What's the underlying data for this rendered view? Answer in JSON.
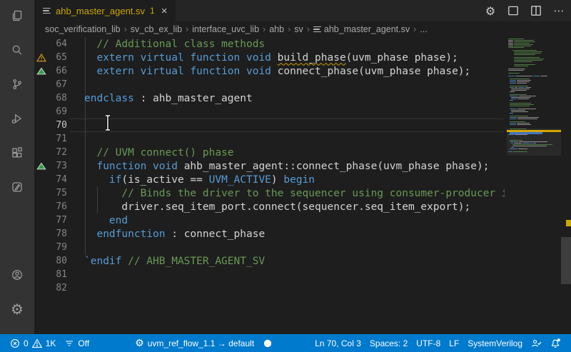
{
  "window": {
    "tab": {
      "label": "ahb_master_agent.sv",
      "badge": "1",
      "close_glyph": "×"
    },
    "editor_actions": [
      {
        "name": "settings-gear"
      },
      {
        "name": "customize-layout"
      },
      {
        "name": "split-editor"
      },
      {
        "name": "more-actions"
      }
    ]
  },
  "breadcrumb": {
    "separator": "›",
    "items": [
      {
        "label": "soc_verification_lib"
      },
      {
        "label": "sv_cb_ex_lib"
      },
      {
        "label": "interface_uvc_lib"
      },
      {
        "label": "ahb"
      },
      {
        "label": "sv"
      },
      {
        "label": "ahb_master_agent.sv",
        "icon": "file"
      },
      {
        "label": "..."
      }
    ]
  },
  "activity_bar": {
    "top": [
      "explorer",
      "search",
      "source-control",
      "run-debug",
      "extensions",
      "notebook-pencil"
    ],
    "bottom": [
      "account",
      "settings-gear"
    ]
  },
  "editor": {
    "current_line": 70,
    "cursor": {
      "line": 70,
      "col": 3
    },
    "lines": [
      {
        "n": 64,
        "tokens": [
          [
            "  // Additional class methods",
            "cm"
          ]
        ]
      },
      {
        "n": 65,
        "gutter": "warning",
        "tokens": [
          [
            "  ",
            "pl"
          ],
          [
            "extern virtual function void ",
            "kw"
          ],
          [
            "build_phase",
            "sq"
          ],
          [
            "(uvm_phase phase);",
            "pl"
          ]
        ]
      },
      {
        "n": 66,
        "gutter": "pass",
        "tokens": [
          [
            "  ",
            "pl"
          ],
          [
            "extern virtual function void ",
            "kw"
          ],
          [
            "connect_phase(uvm_phase phase);",
            "pl"
          ]
        ]
      },
      {
        "n": 67,
        "tokens": []
      },
      {
        "n": 68,
        "tokens": [
          [
            "endclass",
            "kw"
          ],
          [
            " : ahb_master_agent",
            "pl"
          ]
        ]
      },
      {
        "n": 69,
        "tokens": []
      },
      {
        "n": 70,
        "tokens": []
      },
      {
        "n": 71,
        "tokens": []
      },
      {
        "n": 72,
        "tokens": [
          [
            "  // UVM connect() phase",
            "cm"
          ]
        ]
      },
      {
        "n": 73,
        "gutter": "pass",
        "tokens": [
          [
            "  ",
            "pl"
          ],
          [
            "function",
            "kw"
          ],
          [
            " ",
            "pl"
          ],
          [
            "void",
            "kw"
          ],
          [
            " ahb_master_agent::connect_phase(uvm_phase phase);",
            "pl"
          ]
        ]
      },
      {
        "n": 74,
        "tokens": [
          [
            "    ",
            "pl"
          ],
          [
            "if",
            "kw"
          ],
          [
            "(is_active == ",
            "pl"
          ],
          [
            "UVM_ACTIVE",
            "kw"
          ],
          [
            ") ",
            "pl"
          ],
          [
            "begin",
            "kw"
          ]
        ]
      },
      {
        "n": 75,
        "tokens": [
          [
            "      // Binds the driver to the sequencer using consumer-producer interface",
            "cm"
          ]
        ]
      },
      {
        "n": 76,
        "tokens": [
          [
            "      driver.seq_item_port.connect(sequencer.seq_item_export);",
            "pl"
          ]
        ]
      },
      {
        "n": 77,
        "tokens": [
          [
            "    ",
            "pl"
          ],
          [
            "end",
            "kw"
          ]
        ]
      },
      {
        "n": 78,
        "tokens": [
          [
            "  ",
            "pl"
          ],
          [
            "endfunction",
            "kw"
          ],
          [
            " : connect_phase",
            "pl"
          ]
        ]
      },
      {
        "n": 79,
        "tokens": []
      },
      {
        "n": 80,
        "tokens": [
          [
            "`endif ",
            "kw"
          ],
          [
            "// AHB_MASTER_AGENT_SV",
            "cm"
          ]
        ]
      },
      {
        "n": 81,
        "tokens": []
      },
      {
        "n": 82,
        "tokens": []
      }
    ]
  },
  "minimap": {
    "pitch": 2,
    "warning_line": 65,
    "blue_line": 66,
    "viewport": {
      "from": 64,
      "to": 82
    },
    "rows": [
      [
        2,
        [
          [
            22,
            "g"
          ]
        ]
      ],
      [
        2,
        [
          [
            7,
            "w"
          ],
          [
            28,
            "g"
          ]
        ]
      ],
      [
        2,
        [
          [
            7,
            "w"
          ],
          [
            30,
            "g"
          ]
        ]
      ],
      [
        2,
        [
          [
            7,
            "w"
          ],
          [
            22,
            "g"
          ]
        ]
      ],
      [
        2,
        [
          [
            7,
            "w"
          ],
          [
            27,
            "g"
          ]
        ]
      ],
      [
        2,
        [
          [
            7,
            "w"
          ],
          [
            24,
            "g"
          ]
        ]
      ],
      [
        2,
        [
          [
            22,
            "g"
          ]
        ]
      ],
      null,
      [
        8,
        [
          [
            34,
            "g"
          ]
        ]
      ],
      [
        10,
        [
          [
            40,
            "g"
          ]
        ]
      ],
      [
        10,
        [
          [
            38,
            "g"
          ]
        ]
      ],
      [
        10,
        [
          [
            30,
            "g"
          ]
        ]
      ],
      null,
      [
        10,
        [
          [
            36,
            "g"
          ]
        ]
      ],
      [
        10,
        [
          [
            42,
            "g"
          ]
        ]
      ],
      [
        10,
        [
          [
            40,
            "g"
          ]
        ]
      ],
      [
        10,
        [
          [
            26,
            "g"
          ]
        ]
      ],
      null,
      [
        10,
        [
          [
            30,
            "g"
          ]
        ]
      ],
      [
        10,
        [
          [
            20,
            "g"
          ]
        ]
      ],
      null,
      [
        2,
        [
          [
            24,
            "w"
          ]
        ]
      ],
      [
        2,
        [
          [
            22,
            "w"
          ]
        ]
      ],
      null,
      [
        2,
        [
          [
            16,
            "g"
          ]
        ]
      ],
      null,
      [
        2,
        [
          [
            9,
            "b"
          ],
          [
            24,
            "w"
          ],
          [
            9,
            "b"
          ],
          [
            10,
            "w"
          ]
        ]
      ],
      null,
      [
        4,
        [
          [
            28,
            "g"
          ]
        ]
      ],
      [
        4,
        [
          [
            9,
            "b"
          ],
          [
            20,
            "w"
          ]
        ]
      ],
      [
        4,
        [
          [
            9,
            "b"
          ],
          [
            18,
            "w"
          ]
        ]
      ],
      [
        4,
        [
          [
            9,
            "b"
          ],
          [
            14,
            "w"
          ]
        ]
      ],
      null,
      [
        4,
        [
          [
            26,
            "g"
          ]
        ]
      ],
      [
        4,
        [
          [
            6,
            "b"
          ],
          [
            4,
            "w"
          ],
          [
            9,
            "b"
          ],
          [
            8,
            "w"
          ]
        ]
      ],
      [
        6,
        [
          [
            26,
            "w"
          ]
        ]
      ],
      [
        6,
        [
          [
            22,
            "w"
          ]
        ]
      ],
      [
        4,
        [
          [
            7,
            "w"
          ]
        ]
      ],
      null,
      [
        4,
        [
          [
            24,
            "g"
          ]
        ]
      ],
      [
        4,
        [
          [
            12,
            "b"
          ],
          [
            24,
            "w"
          ]
        ]
      ],
      [
        6,
        [
          [
            28,
            "w"
          ]
        ]
      ],
      [
        6,
        [
          [
            8,
            "b"
          ],
          [
            16,
            "w"
          ]
        ]
      ],
      [
        4,
        [
          [
            5,
            "b"
          ]
        ]
      ],
      null,
      [
        4,
        [
          [
            30,
            "g"
          ]
        ]
      ],
      [
        4,
        [
          [
            34,
            "g"
          ]
        ]
      ],
      [
        4,
        [
          [
            28,
            "g"
          ]
        ]
      ],
      null,
      [
        4,
        [
          [
            10,
            "b"
          ],
          [
            26,
            "w"
          ]
        ]
      ],
      [
        6,
        [
          [
            20,
            "w"
          ]
        ]
      ],
      [
        6,
        [
          [
            24,
            "w"
          ]
        ]
      ],
      [
        4,
        [
          [
            5,
            "b"
          ]
        ]
      ],
      null,
      [
        4,
        [
          [
            26,
            "g"
          ]
        ]
      ],
      [
        4,
        [
          [
            10,
            "b"
          ],
          [
            30,
            "w"
          ]
        ]
      ],
      [
        4,
        [
          [
            10,
            "b"
          ],
          [
            28,
            "w"
          ]
        ]
      ],
      null,
      [
        4,
        [
          [
            22,
            "g"
          ]
        ]
      ],
      [
        4,
        [
          [
            9,
            "b"
          ],
          [
            18,
            "w"
          ]
        ]
      ],
      [
        4,
        [
          [
            9,
            "b"
          ],
          [
            20,
            "w"
          ]
        ]
      ],
      null,
      null,
      [
        4,
        [
          [
            24,
            "g"
          ]
        ]
      ],
      [
        4,
        [
          [
            26,
            "b"
          ],
          [
            26,
            "w"
          ]
        ]
      ],
      [
        4,
        [
          [
            26,
            "b"
          ],
          [
            28,
            "w"
          ]
        ]
      ],
      null,
      [
        2,
        [
          [
            8,
            "b"
          ],
          [
            18,
            "w"
          ]
        ]
      ],
      null,
      null,
      null,
      [
        4,
        [
          [
            18,
            "g"
          ]
        ]
      ],
      [
        4,
        [
          [
            12,
            "b"
          ],
          [
            40,
            "w"
          ]
        ]
      ],
      [
        6,
        [
          [
            3,
            "b"
          ],
          [
            11,
            "w"
          ],
          [
            10,
            "b"
          ],
          [
            2,
            "w"
          ],
          [
            5,
            "b"
          ]
        ]
      ],
      [
        8,
        [
          [
            56,
            "g"
          ]
        ]
      ],
      [
        8,
        [
          [
            48,
            "w"
          ]
        ]
      ],
      [
        6,
        [
          [
            4,
            "b"
          ]
        ]
      ],
      [
        4,
        [
          [
            11,
            "b"
          ],
          [
            13,
            "w"
          ]
        ]
      ],
      null,
      [
        2,
        [
          [
            6,
            "b"
          ],
          [
            20,
            "g"
          ]
        ]
      ],
      null,
      null
    ]
  },
  "status_bar": {
    "problems": {
      "error_count": "0",
      "warning_count": "1K"
    },
    "items_left": [
      {
        "icon": "filter",
        "label": "Off"
      },
      {
        "icon": "gear",
        "label": "uvm_ref_flow_1.1 → default",
        "gap": true
      },
      {
        "icon": "circle-filled",
        "label": ""
      }
    ],
    "items_right": [
      {
        "label": "Ln 70, Col 3"
      },
      {
        "label": "Spaces: 2"
      },
      {
        "label": "UTF-8"
      },
      {
        "label": "LF"
      },
      {
        "label": "SystemVerilog"
      },
      {
        "icon": "feedback"
      },
      {
        "icon": "bell-dot"
      }
    ]
  },
  "colors": {
    "status_bar": "#007acc",
    "activity_bar": "#333333",
    "editor_bg": "#1e1e1e",
    "tab_strip": "#252526",
    "keyword": "#569cd6",
    "comment": "#6a9955",
    "plain": "#d4d4d4",
    "warning": "#cca700",
    "minimap_green": "#4e7a43",
    "minimap_blue": "#4a7aa5",
    "minimap_gray": "#8c8c8c"
  }
}
